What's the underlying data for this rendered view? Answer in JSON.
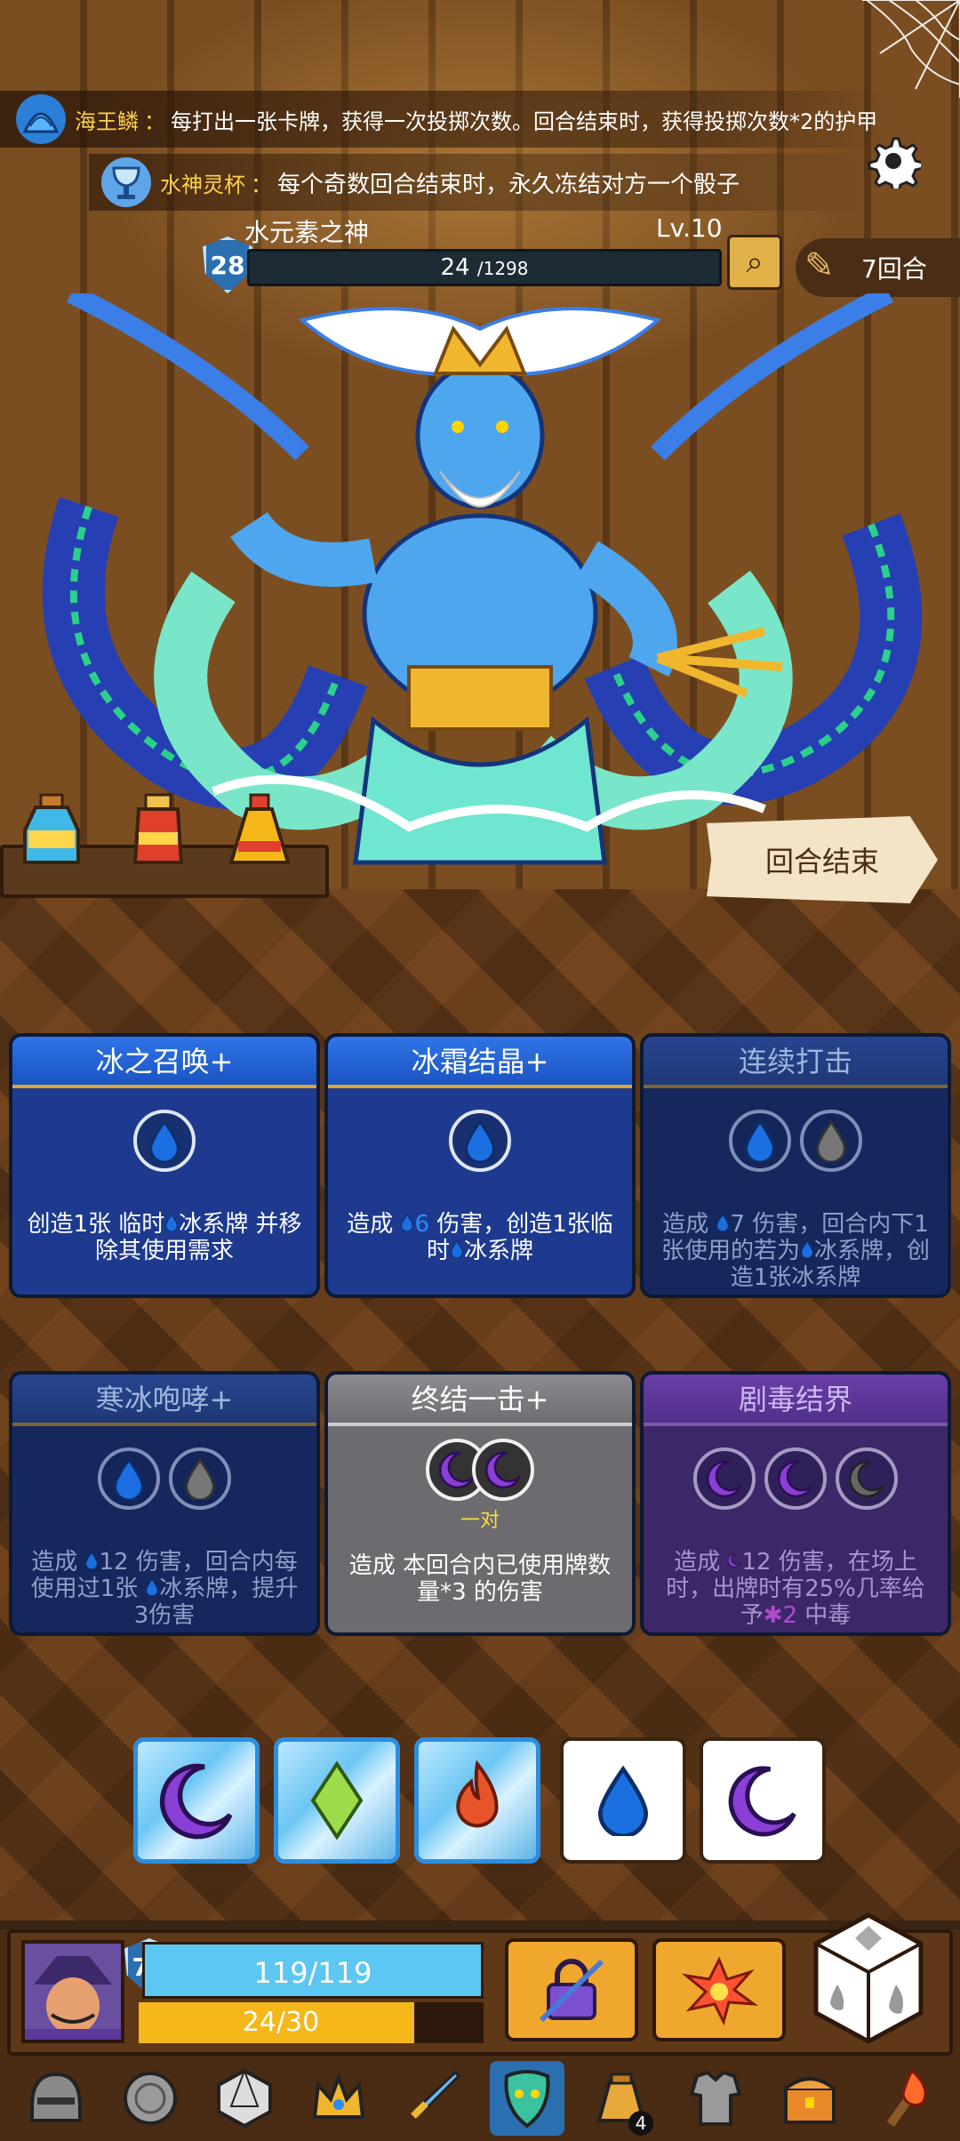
{
  "relics": [
    {
      "name": "海王鳞",
      "sep": "：",
      "text": "每打出一张卡牌，获得一次投掷次数。回合结束时，获得投掷次数*2的护甲"
    },
    {
      "name": "水神灵杯",
      "sep": "：",
      "text": "每个奇数回合结束时，永久冻结对方一个骰子"
    }
  ],
  "enemy": {
    "name": "水元素之神",
    "level": "Lv.10",
    "armor": "28",
    "hp": "24",
    "hp_max": "/1298"
  },
  "turn": {
    "label": "7回合"
  },
  "end_turn_label": "回合结束",
  "cards": [
    {
      "title": "冰之召唤+",
      "desc_parts": [
        "创造1张 临时",
        "冰系牌 并移除其使用需求"
      ],
      "state": "blue"
    },
    {
      "title": "冰霜结晶+",
      "desc_parts": [
        "造成 ",
        "6",
        " 伤害，创造1张临时",
        "冰系牌"
      ],
      "state": "blue"
    },
    {
      "title": "连续打击",
      "desc_parts": [
        "造成 ",
        "7",
        " 伤害，回合内下1张使用的若为",
        "冰系牌，创造1张冰系牌"
      ],
      "state": "dim"
    },
    {
      "title": "寒冰咆哮+",
      "desc_parts": [
        "造成 ",
        "12",
        " 伤害，回合内每使用过1张 ",
        "冰系牌，提升3伤害"
      ],
      "state": "dim"
    },
    {
      "title": "终结一击+",
      "pair": "一对",
      "desc": "造成 本回合内已使用牌数量*3 的伤害",
      "state": "gray"
    },
    {
      "title": "剧毒结界",
      "desc_parts": [
        "造成 ",
        "12",
        " 伤害，在场上时，出牌时有25%几率给予",
        "2",
        " 中毒"
      ],
      "state": "purple"
    }
  ],
  "player": {
    "armor": "73",
    "hp": "119/119",
    "energy": "24/30",
    "energy_fraction": 0.8
  },
  "inventory": {
    "items": [
      "helmet-icon",
      "coin-icon",
      "d20-icon",
      "crown-icon",
      "sword-icon",
      "mask-icon",
      "bag-icon",
      "armor-icon",
      "chest-icon",
      "torch-icon"
    ],
    "bag_count": "4"
  },
  "colors": {
    "water": "#1b6fe0",
    "moon": "#8a3fd6",
    "gold": "#ffd24a"
  }
}
